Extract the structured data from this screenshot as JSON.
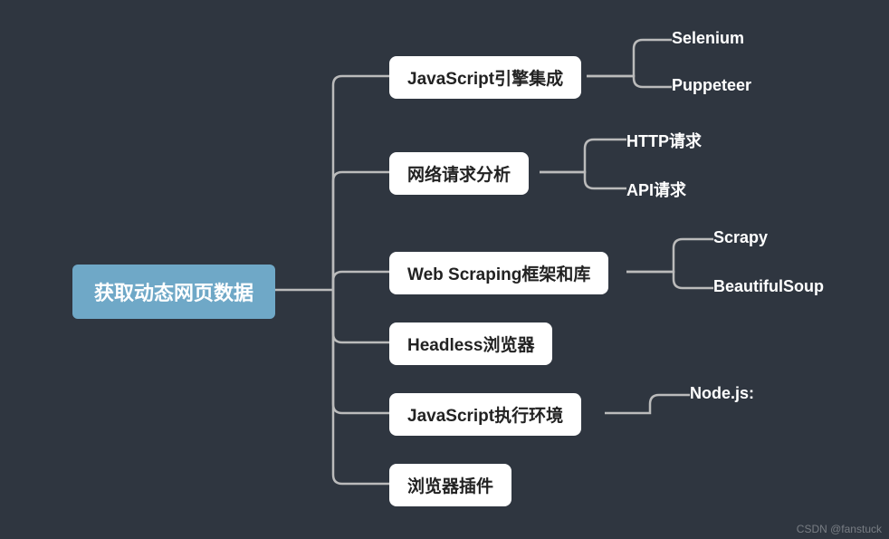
{
  "root": {
    "label": "获取动态网页数据"
  },
  "branches": {
    "b1": {
      "label": "JavaScript引擎集成"
    },
    "b2": {
      "label": "网络请求分析"
    },
    "b3": {
      "label": "Web Scraping框架和库"
    },
    "b4": {
      "label": "Headless浏览器"
    },
    "b5": {
      "label": "JavaScript执行环境"
    },
    "b6": {
      "label": "浏览器插件"
    }
  },
  "leaves": {
    "l1a": {
      "label": "Selenium"
    },
    "l1b": {
      "label": "Puppeteer"
    },
    "l2a": {
      "label": "HTTP请求"
    },
    "l2b": {
      "label": "API请求"
    },
    "l3a": {
      "label": "Scrapy"
    },
    "l3b": {
      "label": "BeautifulSoup"
    },
    "l5a": {
      "label": "Node.js:"
    }
  },
  "attribution": "CSDN @fanstuck"
}
